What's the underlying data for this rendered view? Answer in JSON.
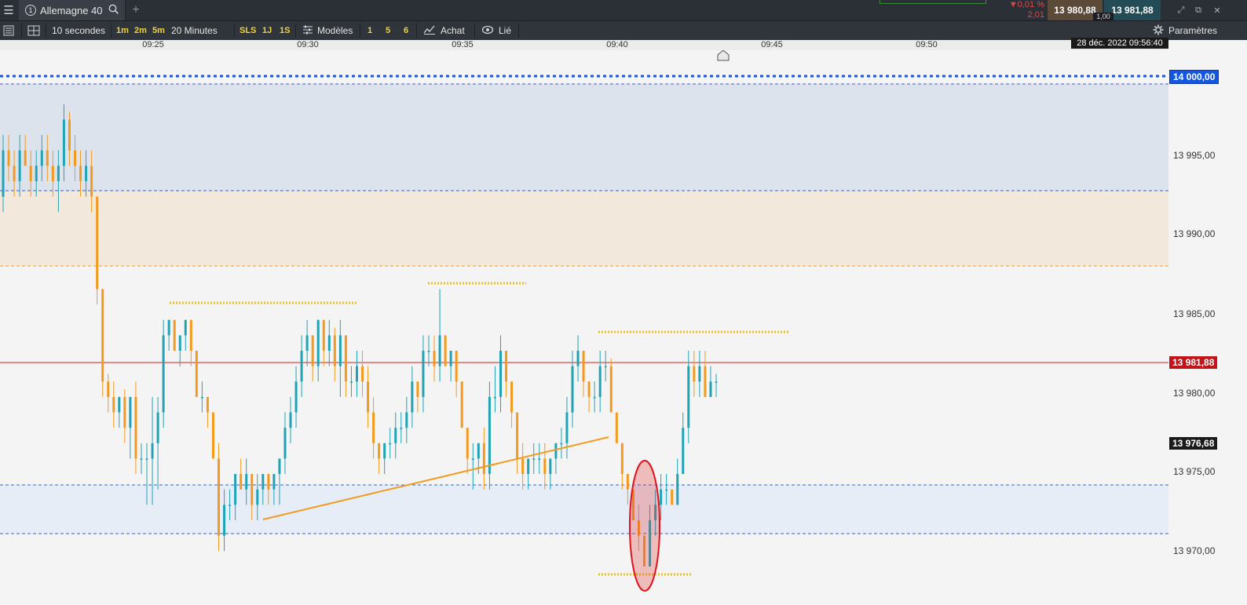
{
  "topbar": {
    "instrument_number": "1",
    "instrument_name": "Allemagne 40",
    "change_percent": "▼0,01 %",
    "change_points": "2,01",
    "bid": "13 980,88",
    "ask": "13 981,88",
    "spread": "1,00"
  },
  "toolbar": {
    "interval": "10 secondes",
    "quick_1m": "1m",
    "quick_2m": "2m",
    "quick_5m": "5m",
    "range": "20 Minutes",
    "sls": "SLS",
    "q_1j": "1J",
    "q_1s": "1S",
    "templates": "Modèles",
    "t1": "1",
    "t5": "5",
    "t6": "6",
    "trade": "Achat",
    "linked": "Lié",
    "settings": "Paramètres"
  },
  "time_axis": {
    "labels": [
      "09:25",
      "09:30",
      "09:35",
      "09:40",
      "09:45",
      "09:50"
    ],
    "datetime": "28 déc. 2022 09:56:40"
  },
  "price_axis": {
    "labels": [
      "13 995,00",
      "13 990,00",
      "13 985,00",
      "13 980,00",
      "13 975,00",
      "13 970,00"
    ],
    "level_tag": "14 000,00",
    "current_price": "13 981,88",
    "crosshair_price": "13 976,68"
  },
  "colors": {
    "bull": "#1fa3b5",
    "bear": "#f39a1e",
    "current_line": "#d51f1f",
    "level_blue": "#1456e0",
    "dotted_yellow": "#e6c31a",
    "trendline": "#f39a1e"
  },
  "chart_data": {
    "type": "candlestick",
    "ylim": [
      13967.5,
      14003.5
    ],
    "ohlc": [
      [
        13994,
        13998,
        13993,
        13997
      ],
      [
        13997,
        13998,
        13995,
        13996
      ],
      [
        13996,
        13997,
        13994,
        13995
      ],
      [
        13995,
        13998,
        13994,
        13997
      ],
      [
        13997,
        13998,
        13996,
        13996
      ],
      [
        13996,
        13997,
        13994,
        13995
      ],
      [
        13995,
        13997,
        13994,
        13996
      ],
      [
        13996,
        13998,
        13995,
        13997
      ],
      [
        13997,
        13998,
        13995,
        13996
      ],
      [
        13996,
        13997,
        13994,
        13995
      ],
      [
        13995,
        13997,
        13993,
        13996
      ],
      [
        13996,
        14000,
        13995,
        13999
      ],
      [
        13999,
        13999.5,
        13996,
        13997
      ],
      [
        13997,
        13998,
        13995,
        13996
      ],
      [
        13996,
        13997,
        13994,
        13995
      ],
      [
        13995,
        13997,
        13994,
        13996
      ],
      [
        13996,
        13997,
        13993,
        13994
      ],
      [
        13994,
        13994,
        13987,
        13988
      ],
      [
        13988,
        13988,
        13981,
        13982
      ],
      [
        13982,
        13982.5,
        13980,
        13981
      ],
      [
        13981,
        13982,
        13979,
        13980
      ],
      [
        13980,
        13981,
        13979,
        13981
      ],
      [
        13981,
        13981.5,
        13978,
        13979
      ],
      [
        13979,
        13981,
        13977,
        13981
      ],
      [
        13981,
        13982,
        13976,
        13977
      ],
      [
        13977,
        13978,
        13976,
        13977
      ],
      [
        13977,
        13978,
        13974,
        13977
      ],
      [
        13977,
        13981,
        13974,
        13978
      ],
      [
        13978,
        13981,
        13975,
        13980
      ],
      [
        13980,
        13986,
        13979,
        13985
      ],
      [
        13985,
        13986,
        13984,
        13986
      ],
      [
        13986,
        13986,
        13984,
        13984
      ],
      [
        13984,
        13985,
        13983,
        13985
      ],
      [
        13985,
        13986,
        13984,
        13986
      ],
      [
        13986,
        13986,
        13983,
        13984
      ],
      [
        13984,
        13984,
        13981,
        13981
      ],
      [
        13981,
        13982,
        13980,
        13981
      ],
      [
        13981,
        13981,
        13979,
        13980
      ],
      [
        13980,
        13980,
        13977,
        13977
      ],
      [
        13977,
        13978,
        13971,
        13972
      ],
      [
        13972,
        13975,
        13971,
        13974
      ],
      [
        13974,
        13975,
        13973,
        13974
      ],
      [
        13974,
        13976,
        13973,
        13976
      ],
      [
        13976,
        13977,
        13975,
        13975
      ],
      [
        13975,
        13977,
        13974,
        13976
      ],
      [
        13976,
        13976,
        13973,
        13974
      ],
      [
        13974,
        13976,
        13973,
        13975
      ],
      [
        13975,
        13976,
        13974,
        13976
      ],
      [
        13976,
        13976,
        13974,
        13975
      ],
      [
        13975,
        13976,
        13974,
        13976
      ],
      [
        13976,
        13977,
        13974,
        13977
      ],
      [
        13977,
        13980,
        13976,
        13979
      ],
      [
        13979,
        13981,
        13978,
        13980
      ],
      [
        13980,
        13983,
        13979,
        13982
      ],
      [
        13982,
        13985,
        13981,
        13984
      ],
      [
        13984,
        13986,
        13983,
        13985
      ],
      [
        13985,
        13985,
        13982,
        13983
      ],
      [
        13983,
        13986,
        13982,
        13986
      ],
      [
        13986,
        13986,
        13983,
        13984
      ],
      [
        13984,
        13986,
        13983,
        13985
      ],
      [
        13985,
        13985.5,
        13982,
        13983
      ],
      [
        13983,
        13986,
        13981,
        13985
      ],
      [
        13985,
        13985,
        13981,
        13982
      ],
      [
        13982,
        13983,
        13981,
        13982
      ],
      [
        13982,
        13984,
        13981,
        13983
      ],
      [
        13983,
        13984,
        13981,
        13982
      ],
      [
        13982,
        13983,
        13979,
        13980
      ],
      [
        13980,
        13981,
        13977,
        13978
      ],
      [
        13978,
        13978,
        13976,
        13977
      ],
      [
        13977,
        13978,
        13976,
        13978
      ],
      [
        13978,
        13979,
        13977,
        13978
      ],
      [
        13978,
        13980,
        13977,
        13979
      ],
      [
        13979,
        13980,
        13978,
        13979
      ],
      [
        13979,
        13981,
        13978,
        13980
      ],
      [
        13980,
        13983,
        13979,
        13982
      ],
      [
        13982,
        13982,
        13980,
        13981
      ],
      [
        13981,
        13985,
        13980,
        13984
      ],
      [
        13984,
        13985,
        13983,
        13984
      ],
      [
        13984,
        13985,
        13982,
        13983
      ],
      [
        13983,
        13988,
        13982,
        13985
      ],
      [
        13985,
        13985,
        13983,
        13983
      ],
      [
        13983,
        13984,
        13982,
        13984
      ],
      [
        13984,
        13984,
        13981,
        13982
      ],
      [
        13982,
        13982,
        13979,
        13979
      ],
      [
        13979,
        13979,
        13976,
        13977
      ],
      [
        13977,
        13978,
        13975,
        13977
      ],
      [
        13977,
        13978,
        13976,
        13978
      ],
      [
        13978,
        13979,
        13975,
        13976
      ],
      [
        13976,
        13982,
        13975,
        13981
      ],
      [
        13981,
        13983,
        13980,
        13981
      ],
      [
        13981,
        13985,
        13980,
        13984
      ],
      [
        13984,
        13984,
        13981,
        13982
      ],
      [
        13982,
        13982,
        13979,
        13980
      ],
      [
        13980,
        13980,
        13976,
        13977
      ],
      [
        13977,
        13978,
        13975,
        13976
      ],
      [
        13976,
        13977,
        13975,
        13977
      ],
      [
        13977,
        13978,
        13976,
        13977
      ],
      [
        13977,
        13978,
        13976,
        13977
      ],
      [
        13977,
        13978,
        13975,
        13976
      ],
      [
        13976,
        13977,
        13975,
        13977
      ],
      [
        13977,
        13978,
        13976,
        13978
      ],
      [
        13978,
        13979,
        13977,
        13978
      ],
      [
        13978,
        13981,
        13977,
        13980
      ],
      [
        13980,
        13984,
        13979,
        13983
      ],
      [
        13983,
        13985,
        13982,
        13984
      ],
      [
        13984,
        13984,
        13981,
        13982
      ],
      [
        13982,
        13982,
        13980,
        13981
      ],
      [
        13981,
        13982,
        13980,
        13981
      ],
      [
        13981,
        13984,
        13980,
        13983
      ],
      [
        13983,
        13984,
        13982,
        13983
      ],
      [
        13983,
        13983.5,
        13980,
        13980
      ],
      [
        13980,
        13980,
        13978,
        13978
      ],
      [
        13978,
        13978,
        13975,
        13976
      ],
      [
        13976,
        13976,
        13974,
        13975
      ],
      [
        13975,
        13975,
        13973,
        13973
      ],
      [
        13973,
        13974,
        13971,
        13972
      ],
      [
        13972,
        13972,
        13970,
        13970
      ],
      [
        13970,
        13974,
        13970,
        13973
      ],
      [
        13973,
        13975,
        13972,
        13974
      ],
      [
        13974,
        13976,
        13973,
        13975
      ],
      [
        13975,
        13976,
        13974,
        13975
      ],
      [
        13975,
        13975,
        13974,
        13974
      ],
      [
        13974,
        13977,
        13974,
        13976
      ],
      [
        13976,
        13980,
        13976,
        13979
      ],
      [
        13979,
        13984,
        13978,
        13983
      ],
      [
        13983,
        13984,
        13981,
        13982
      ],
      [
        13982,
        13984,
        13981,
        13983
      ],
      [
        13983,
        13984,
        13981,
        13981
      ],
      [
        13981,
        13983,
        13981,
        13982
      ],
      [
        13982,
        13982.5,
        13981,
        13982
      ]
    ]
  }
}
